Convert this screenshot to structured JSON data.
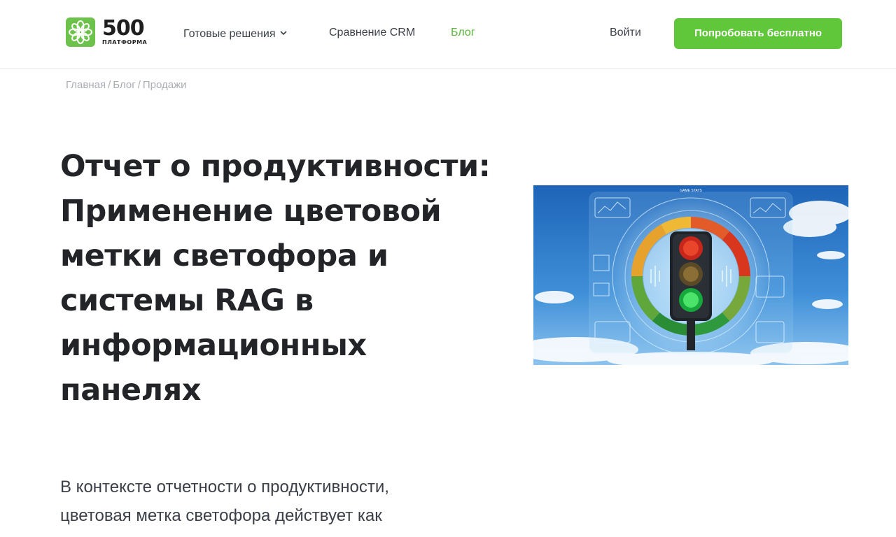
{
  "header": {
    "logo": {
      "number": "500",
      "subtitle": "ПЛАТФОРМА"
    },
    "nav": [
      {
        "label": "Готовые решения"
      },
      {
        "label": "Сравнение CRM"
      },
      {
        "label": "Блог"
      }
    ],
    "login": "Войти",
    "cta": "Попробовать бесплатно"
  },
  "breadcrumb": {
    "items": [
      "Главная",
      "Блог",
      "Продажи"
    ],
    "separator": "/"
  },
  "article": {
    "title": "Отчет о продуктивности: Применение цветовой метки светофора и системы RAG в информационных панелях",
    "lead": "В контексте отчетности о продуктивности, цветовая метка светофора действует как"
  },
  "hero": {
    "dashboard_label": "GAME STATS"
  },
  "colors": {
    "accent": "#61c73a",
    "nav_active": "#58b535",
    "text_dark": "#222427",
    "muted": "#a9adb4"
  }
}
